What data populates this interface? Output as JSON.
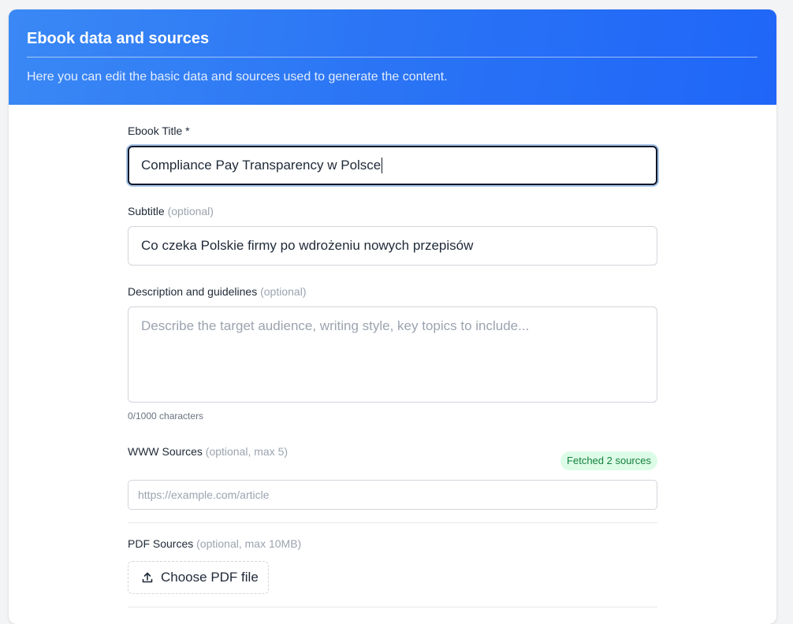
{
  "header": {
    "title": "Ebook data and sources",
    "subtitle": "Here you can edit the basic data and sources used to generate the content."
  },
  "form": {
    "title": {
      "label": "Ebook Title *",
      "value": "Compliance Pay Transparency w Polsce"
    },
    "subtitle": {
      "label": "Subtitle",
      "optional": "(optional)",
      "value": "Co czeka Polskie firmy po wdrożeniu nowych przepisów"
    },
    "description": {
      "label": "Description and guidelines",
      "optional": "(optional)",
      "placeholder": "Describe the target audience, writing style, key topics to include...",
      "value": "",
      "counter": "0/1000 characters"
    },
    "www_sources": {
      "label": "WWW Sources",
      "optional": "(optional, max 5)",
      "badge": "Fetched 2 sources",
      "placeholder": "https://example.com/article",
      "value": ""
    },
    "pdf_sources": {
      "label": "PDF Sources",
      "optional": "(optional, max 10MB)",
      "button_label": "Choose PDF file",
      "button_icon": "upload-icon"
    }
  },
  "colors": {
    "header_gradient_start": "#3a88f5",
    "header_gradient_end": "#1f66f8",
    "badge_bg": "#dcfce7",
    "badge_text": "#15803d",
    "focus_border": "#0f172a"
  }
}
